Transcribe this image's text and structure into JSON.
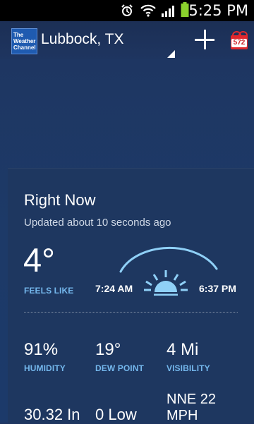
{
  "status_bar": {
    "time": "5:25 PM",
    "icons": [
      "alarm-icon",
      "wifi-icon",
      "signal-icon",
      "battery-icon"
    ]
  },
  "app_bar": {
    "logo_text": [
      "The",
      "Weather",
      "Channel"
    ],
    "location": "Lubbock, TX",
    "add_icon": "plus-icon",
    "gift_count": "572"
  },
  "right_now": {
    "title": "Right Now",
    "updated": "Updated about 10 seconds ago",
    "temperature": "4°",
    "feels_like_label": "FEELS LIKE",
    "sunrise": "7:24 AM",
    "sunset": "6:37 PM"
  },
  "stats": [
    {
      "value": "91%",
      "label": "HUMIDITY"
    },
    {
      "value": "19°",
      "label": "DEW POINT"
    },
    {
      "value": "4 Mi",
      "label": "VISIBILITY"
    },
    {
      "value": "30.32 In",
      "label": ""
    },
    {
      "value": "0 Low",
      "label": ""
    },
    {
      "value": "NNE 22 MPH",
      "label": ""
    }
  ],
  "colors": {
    "accent_blue": "#74b7ec",
    "background": "#1e3560",
    "gift_red": "#e0282d"
  }
}
